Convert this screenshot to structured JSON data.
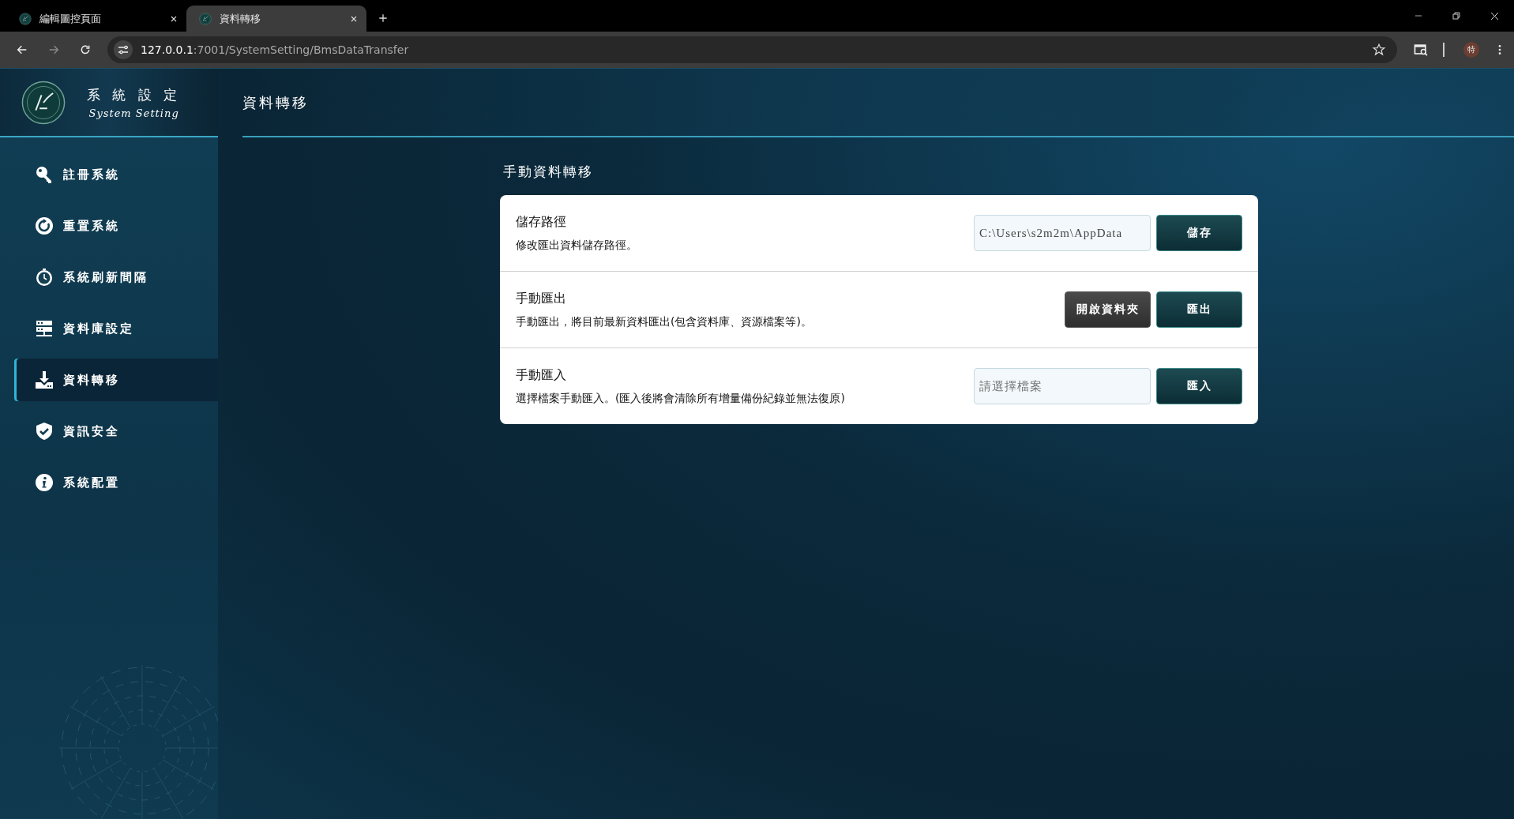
{
  "browser": {
    "tabs": [
      {
        "title": "編輯圖控頁面",
        "selected": false
      },
      {
        "title": "資料轉移",
        "selected": true
      }
    ],
    "url_host": "127.0.0.1",
    "url_rest": ":7001/SystemSetting/BmsDataTransfer",
    "profile": "特"
  },
  "sidebar": {
    "title": "系 統 設 定",
    "subtitle": "System Setting",
    "items": [
      {
        "label": "註冊系統",
        "selected": false
      },
      {
        "label": "重置系統",
        "selected": false
      },
      {
        "label": "系統刷新間隔",
        "selected": false
      },
      {
        "label": "資料庫設定",
        "selected": false
      },
      {
        "label": "資料轉移",
        "selected": true
      },
      {
        "label": "資訊安全",
        "selected": false
      },
      {
        "label": "系統配置",
        "selected": false
      }
    ]
  },
  "page_title": "資料轉移",
  "section_title": "手動資料轉移",
  "rows": [
    {
      "title": "儲存路徑",
      "description": "修改匯出資料儲存路徑。",
      "controls": [
        {
          "kind": "field",
          "value": "C:\\Users\\s2m2m\\AppData"
        },
        {
          "kind": "primary",
          "label": "儲存"
        }
      ]
    },
    {
      "title": "手動匯出",
      "description": "手動匯出，將目前最新資料匯出(包含資料庫、資源檔案等)。",
      "controls": [
        {
          "kind": "secondary",
          "label": "開啟資料夾"
        },
        {
          "kind": "primary",
          "label": "匯出"
        }
      ]
    },
    {
      "title": "手動匯入",
      "description": "選擇檔案手動匯入。(匯入後將會清除所有增量備份紀錄並無法復原)",
      "controls": [
        {
          "kind": "field",
          "placeholder": "請選擇檔案"
        },
        {
          "kind": "primary",
          "label": "匯入"
        }
      ]
    }
  ]
}
